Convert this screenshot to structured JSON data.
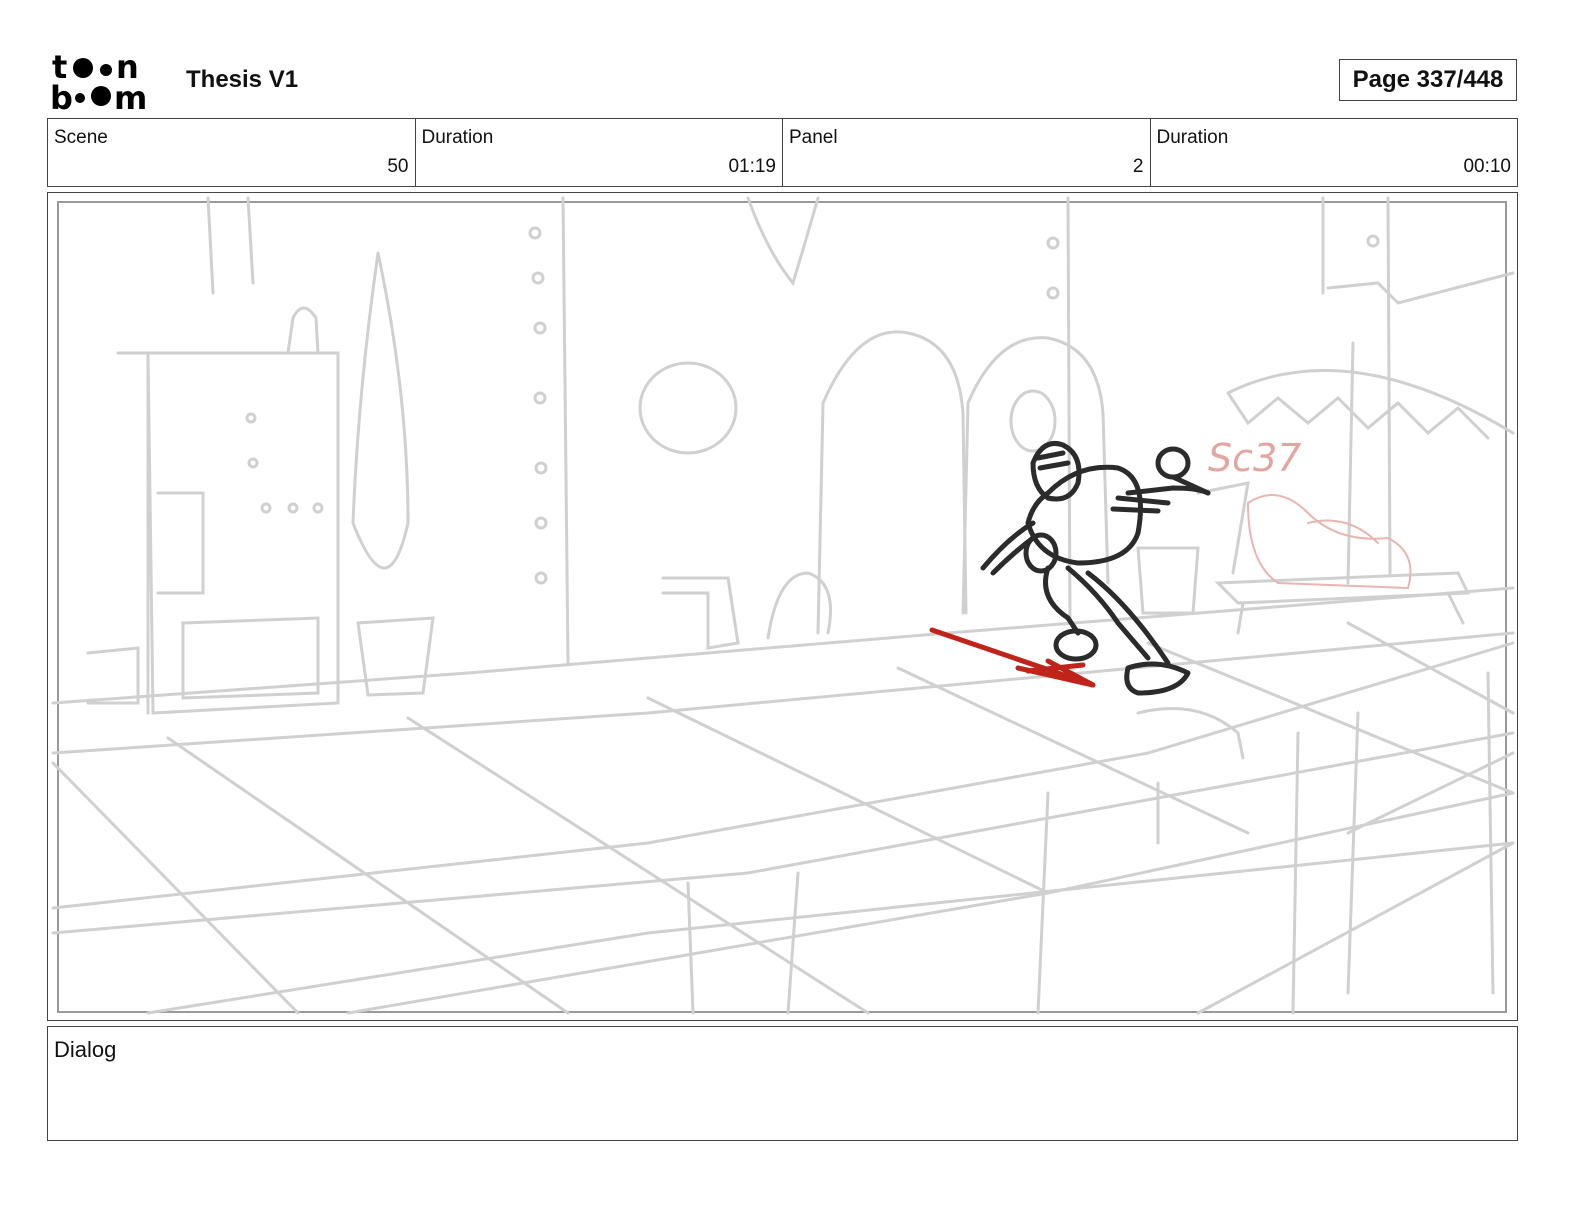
{
  "header": {
    "project_title": "Thesis V1",
    "page_label": "Page 337/448",
    "logo_text": "toonboom"
  },
  "info": {
    "scene_label": "Scene",
    "scene_value": "50",
    "scene_duration_label": "Duration",
    "scene_duration_value": "01:19",
    "panel_label": "Panel",
    "panel_value": "2",
    "panel_duration_label": "Duration",
    "panel_duration_value": "00:10"
  },
  "panel": {
    "sketch_note": "Sc37",
    "colors": {
      "background_lines": "#cfcfcf",
      "character": "#2a2a2a",
      "motion_arrow": "#c0231a",
      "note": "#e3a5a0"
    }
  },
  "dialog": {
    "label": "Dialog"
  }
}
